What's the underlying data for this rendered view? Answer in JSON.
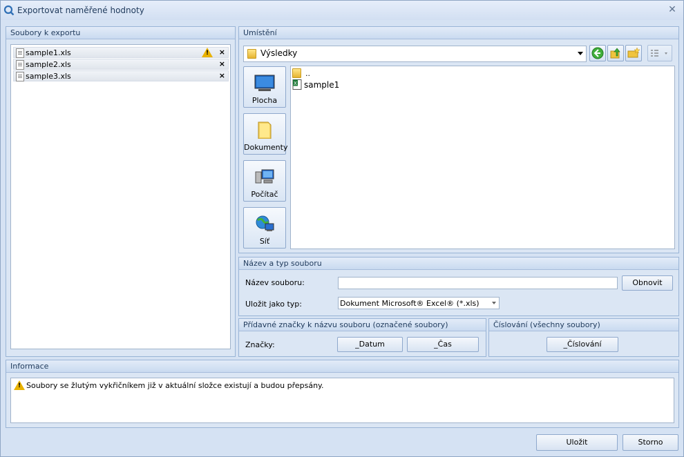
{
  "window": {
    "title": "Exportovat naměřené hodnoty"
  },
  "files_panel": {
    "header": "Soubory k exportu",
    "files": [
      {
        "name": "sample1.xls",
        "warning": true
      },
      {
        "name": "sample2.xls",
        "warning": false
      },
      {
        "name": "sample3.xls",
        "warning": false
      }
    ],
    "delete_glyph": "×"
  },
  "location_panel": {
    "header": "Umístění",
    "current_folder": "Výsledky",
    "places": [
      {
        "label": "Plocha",
        "icon": "desktop-icon"
      },
      {
        "label": "Dokumenty",
        "icon": "documents-folder-icon"
      },
      {
        "label": "Počítač",
        "icon": "computer-icon"
      },
      {
        "label": "Síť",
        "icon": "network-icon"
      }
    ],
    "browser_items": [
      {
        "label": "..",
        "icon": "parent-folder-icon"
      },
      {
        "label": "sample1",
        "icon": "excel-file-icon"
      }
    ]
  },
  "name_panel": {
    "header": "Název a typ souboru",
    "filename_label": "Název souboru:",
    "filename_value": "",
    "refresh_button": "Obnovit",
    "type_label": "Uložit jako typ:",
    "type_value": "Dokument Microsoft® Excel® (*.xls)"
  },
  "tags_panel": {
    "header": "Přídavné značky k názvu souboru (označené soubory)",
    "label": "Značky:",
    "date_button": "_Datum",
    "time_button": "_Čas"
  },
  "numbering_panel": {
    "header": "Číslování (všechny soubory)",
    "button": "_Číslování"
  },
  "info_panel": {
    "header": "Informace",
    "message": "Soubory se žlutým vykřičníkem již v aktuální složce existují a budou přepsány."
  },
  "footer": {
    "save_button": "Uložit",
    "cancel_button": "Storno"
  },
  "colors": {
    "frame": "#d5e2f3",
    "header_text": "#1e395b",
    "warning": "#e9b200"
  }
}
